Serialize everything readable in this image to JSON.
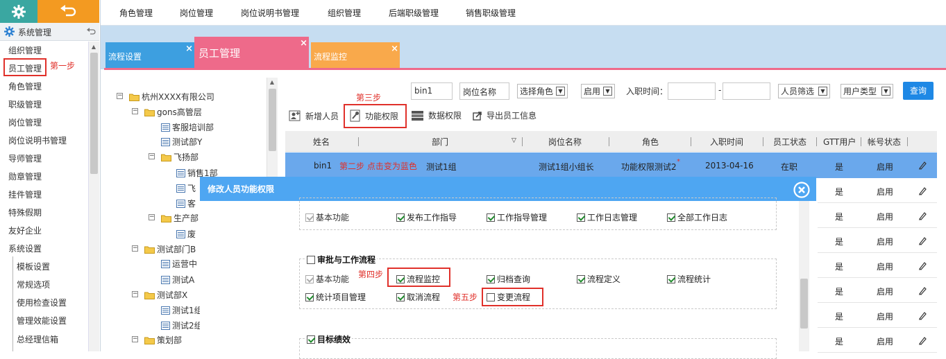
{
  "sidebar": {
    "title": "系统管理",
    "items": [
      "组织管理",
      "员工管理",
      "角色管理",
      "职级管理",
      "岗位管理",
      "岗位说明书管理",
      "导师管理",
      "勋章管理",
      "挂件管理",
      "特殊假期",
      "友好企业",
      "系统设置"
    ],
    "subitems": [
      "模板设置",
      "常规选项",
      "使用检查设置",
      "管理效能设置",
      "总经理信箱"
    ]
  },
  "topnav": [
    "角色管理",
    "岗位管理",
    "岗位说明书管理",
    "组织管理",
    "后端职级管理",
    "销售职级管理"
  ],
  "tabs": {
    "left": "流程设置",
    "active": "员工管理",
    "right": "流程监控",
    "close": "×"
  },
  "tree": {
    "root": "杭州XXXX有限公司",
    "nodes": [
      "gons高管层",
      "客服培训部",
      "测试部Y",
      "飞扬部",
      "销售1部",
      "飞",
      "客",
      "生产部",
      "废",
      "测试部门B",
      "运营中",
      "测试A",
      "测试部X",
      "测试1组",
      "测试2组",
      "策划部"
    ]
  },
  "filters": {
    "keyword": "bin1",
    "position_placeholder": "岗位名称",
    "role": "选择角色",
    "status": "启用",
    "join_label": "入职时间：",
    "dash": "-",
    "staff_filter": "人员筛选",
    "user_type": "用户类型",
    "query": "查询"
  },
  "toolbar": {
    "add": "新增人员",
    "func": "功能权限",
    "data": "数据权限",
    "export": "导出员工信息"
  },
  "table": {
    "headers": [
      "姓名",
      "部门",
      "岗位名称",
      "角色",
      "入职时间",
      "员工状态",
      "GTT用户",
      "帐号状态"
    ],
    "selected": {
      "name": "bin1",
      "dept": "测试1组",
      "post": "测试1组小组长",
      "role": "功能权限测试2",
      "star": "*",
      "date": "2013-04-16",
      "status": "在职",
      "gtt": "是",
      "account": "启用"
    },
    "rest": [
      {
        "gtt": "是",
        "account": "启用"
      },
      {
        "gtt": "是",
        "account": "启用"
      },
      {
        "gtt": "是",
        "account": "启用"
      },
      {
        "gtt": "是",
        "account": "启用"
      },
      {
        "gtt": "是",
        "account": "启用"
      },
      {
        "gtt": "是",
        "account": "启用"
      },
      {
        "gtt": "是",
        "account": "启用"
      }
    ]
  },
  "annotations": {
    "step1": "第一步",
    "step2": "第二步 点击变为蓝色",
    "step3": "第三步",
    "step4": "第四步",
    "step5": "第五步"
  },
  "modal": {
    "title": "修改人员功能权限",
    "group1": {
      "items": [
        "基本功能",
        "发布工作指导",
        "工作指导管理",
        "工作日志管理",
        "全部工作日志"
      ]
    },
    "group2": {
      "legend": "审批与工作流程",
      "row1": [
        "基本功能",
        "流程监控",
        "归档查询",
        "流程定义",
        "流程统计"
      ],
      "row2": [
        "统计项目管理",
        "取消流程",
        "变更流程"
      ]
    },
    "group3": {
      "legend": "目标绩效"
    }
  },
  "colors": {
    "teal": "#3aa7a1",
    "orange": "#f39a21",
    "accent_blue": "#1e88e5",
    "tab_pink": "#ee6a8a",
    "selected_row": "#6aa8ec",
    "annotation_red": "#e0302a"
  }
}
